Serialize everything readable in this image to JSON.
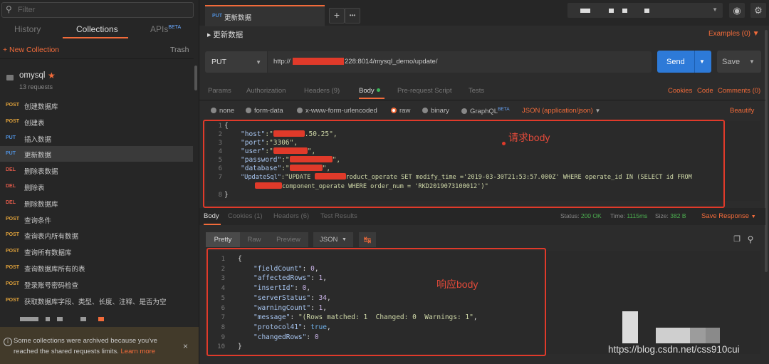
{
  "sidebar": {
    "filter_placeholder": "Filter",
    "tabs": {
      "history": "History",
      "collections": "Collections",
      "apis": "APIs",
      "apis_badge": "BETA"
    },
    "new_collection": "+ New Collection",
    "trash": "Trash",
    "collection": {
      "name": "omysql",
      "count": "13 requests"
    },
    "requests": [
      {
        "method": "POST",
        "name": "创建数据库"
      },
      {
        "method": "POST",
        "name": "创建表"
      },
      {
        "method": "PUT",
        "name": "插入数据"
      },
      {
        "method": "PUT",
        "name": "更新数据"
      },
      {
        "method": "DEL",
        "name": "删除表数据"
      },
      {
        "method": "DEL",
        "name": "删除表"
      },
      {
        "method": "DEL",
        "name": "删除数据库"
      },
      {
        "method": "POST",
        "name": "查询条件"
      },
      {
        "method": "POST",
        "name": "查询表内所有数据"
      },
      {
        "method": "POST",
        "name": "查询所有数据库"
      },
      {
        "method": "POST",
        "name": "查询数据库所有的表"
      },
      {
        "method": "POST",
        "name": "登录账号密码检查"
      },
      {
        "method": "POST",
        "name": "获取数据库字段、类型、长度、注释、是否为空"
      }
    ],
    "selected_index": 3,
    "banner": {
      "text": "Some collections were archived because you've reached the shared requests limits.",
      "link": "Learn more",
      "close": "×"
    }
  },
  "tab": {
    "method": "PUT",
    "name": "更新数据",
    "add": "+",
    "more": "•••"
  },
  "request": {
    "title": "更新数据",
    "examples": "Examples (0)",
    "method": "PUT",
    "url_prefix": "http://",
    "url_suffix": "228:8014/mysql_demo/update/",
    "send": "Send",
    "save": "Save",
    "tabs": [
      "Params",
      "Authorization",
      "Headers (9)",
      "Body",
      "Pre-request Script",
      "Tests"
    ],
    "active_tab": "Body",
    "right_links": [
      "Cookies",
      "Code",
      "Comments (0)"
    ],
    "body_types": [
      "none",
      "form-data",
      "x-www-form-urlencoded",
      "raw",
      "binary",
      "GraphQL"
    ],
    "graphql_badge": "BETA",
    "selected_body_type": "raw",
    "content_type": "JSON (application/json)",
    "beautify": "Beautify",
    "body_lines": [
      {
        "n": "1",
        "text": "{"
      },
      {
        "n": "2",
        "key": "\"host\"",
        "pre": ":\"",
        "post": ".50.25\","
      },
      {
        "n": "3",
        "key": "\"port\"",
        "pre": ":\"3306\","
      },
      {
        "n": "4",
        "key": "\"user\"",
        "pre": ":\"",
        "post": "\","
      },
      {
        "n": "5",
        "key": "\"password\"",
        "pre": ":\"",
        "post": "\","
      },
      {
        "n": "6",
        "key": "\"database\"",
        "pre": ":\"",
        "post": "\","
      },
      {
        "n": "7",
        "key": "\"UpdateSql\"",
        "pre": ":\"UPDATE ",
        "post": "roduct_operate SET modify_time ='2019-03-30T21:53:57.000Z' WHERE operate_id IN (SELECT id FROM"
      },
      {
        "n": "",
        "post": "component_operate WHERE order_num = 'RKD2019073100012')\""
      },
      {
        "n": "8",
        "text": "}"
      }
    ],
    "annotation": "请求body"
  },
  "response": {
    "tabs": [
      "Body",
      "Cookies (1)",
      "Headers (6)",
      "Test Results"
    ],
    "status_label": "Status:",
    "status": "200 OK",
    "time_label": "Time:",
    "time": "1115ms",
    "size_label": "Size:",
    "size": "382 B",
    "save_response": "Save Response",
    "views": [
      "Pretty",
      "Raw",
      "Preview"
    ],
    "format": "JSON",
    "lines": [
      {
        "n": "1",
        "text": "{"
      },
      {
        "n": "2",
        "key": "\"fieldCount\"",
        "val": "0",
        "cls": "num"
      },
      {
        "n": "3",
        "key": "\"affectedRows\"",
        "val": "1",
        "cls": "num"
      },
      {
        "n": "4",
        "key": "\"insertId\"",
        "val": "0",
        "cls": "num"
      },
      {
        "n": "5",
        "key": "\"serverStatus\"",
        "val": "34",
        "cls": "num"
      },
      {
        "n": "6",
        "key": "\"warningCount\"",
        "val": "1",
        "cls": "num"
      },
      {
        "n": "7",
        "key": "\"message\"",
        "val": "\"(Rows matched: 1  Changed: 0  Warnings: 1\"",
        "cls": "str"
      },
      {
        "n": "8",
        "key": "\"protocol41\"",
        "val": "true",
        "cls": "bool"
      },
      {
        "n": "9",
        "key": "\"changedRows\"",
        "val": "0",
        "cls": "num",
        "last": true
      },
      {
        "n": "10",
        "text": "}"
      }
    ],
    "annotation": "响应body"
  },
  "watermark": "https://blog.csdn.net/css910cui",
  "colors": {
    "accent": "#f26b3a",
    "send": "#2d7ad8",
    "post": "#e0a23b",
    "put": "#4f8ed8",
    "del": "#e05a4a",
    "annotation": "#e03a2a"
  }
}
